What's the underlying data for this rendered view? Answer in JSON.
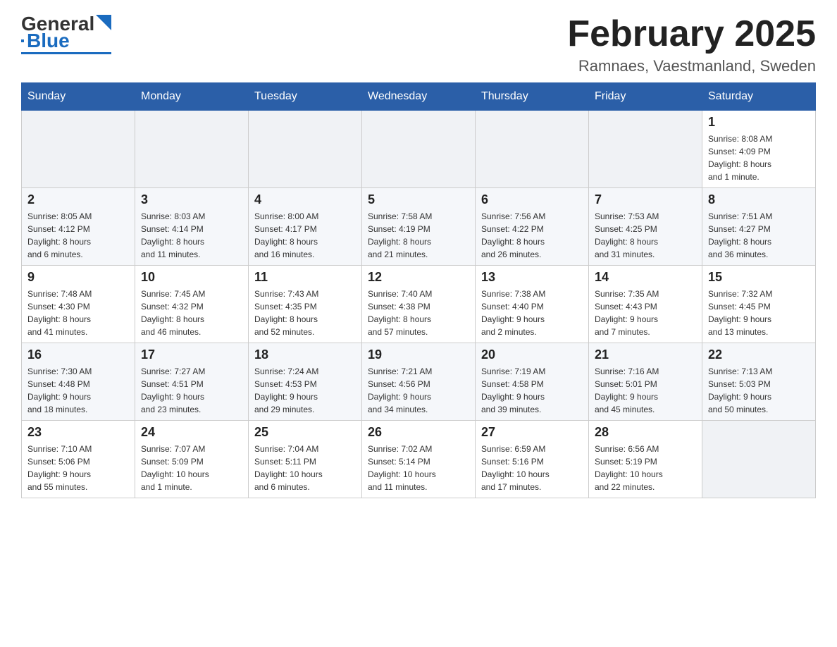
{
  "header": {
    "logo_general": "General",
    "logo_blue": "Blue",
    "title": "February 2025",
    "subtitle": "Ramnaes, Vaestmanland, Sweden"
  },
  "weekdays": [
    "Sunday",
    "Monday",
    "Tuesday",
    "Wednesday",
    "Thursday",
    "Friday",
    "Saturday"
  ],
  "weeks": [
    [
      {
        "day": "",
        "info": ""
      },
      {
        "day": "",
        "info": ""
      },
      {
        "day": "",
        "info": ""
      },
      {
        "day": "",
        "info": ""
      },
      {
        "day": "",
        "info": ""
      },
      {
        "day": "",
        "info": ""
      },
      {
        "day": "1",
        "info": "Sunrise: 8:08 AM\nSunset: 4:09 PM\nDaylight: 8 hours\nand 1 minute."
      }
    ],
    [
      {
        "day": "2",
        "info": "Sunrise: 8:05 AM\nSunset: 4:12 PM\nDaylight: 8 hours\nand 6 minutes."
      },
      {
        "day": "3",
        "info": "Sunrise: 8:03 AM\nSunset: 4:14 PM\nDaylight: 8 hours\nand 11 minutes."
      },
      {
        "day": "4",
        "info": "Sunrise: 8:00 AM\nSunset: 4:17 PM\nDaylight: 8 hours\nand 16 minutes."
      },
      {
        "day": "5",
        "info": "Sunrise: 7:58 AM\nSunset: 4:19 PM\nDaylight: 8 hours\nand 21 minutes."
      },
      {
        "day": "6",
        "info": "Sunrise: 7:56 AM\nSunset: 4:22 PM\nDaylight: 8 hours\nand 26 minutes."
      },
      {
        "day": "7",
        "info": "Sunrise: 7:53 AM\nSunset: 4:25 PM\nDaylight: 8 hours\nand 31 minutes."
      },
      {
        "day": "8",
        "info": "Sunrise: 7:51 AM\nSunset: 4:27 PM\nDaylight: 8 hours\nand 36 minutes."
      }
    ],
    [
      {
        "day": "9",
        "info": "Sunrise: 7:48 AM\nSunset: 4:30 PM\nDaylight: 8 hours\nand 41 minutes."
      },
      {
        "day": "10",
        "info": "Sunrise: 7:45 AM\nSunset: 4:32 PM\nDaylight: 8 hours\nand 46 minutes."
      },
      {
        "day": "11",
        "info": "Sunrise: 7:43 AM\nSunset: 4:35 PM\nDaylight: 8 hours\nand 52 minutes."
      },
      {
        "day": "12",
        "info": "Sunrise: 7:40 AM\nSunset: 4:38 PM\nDaylight: 8 hours\nand 57 minutes."
      },
      {
        "day": "13",
        "info": "Sunrise: 7:38 AM\nSunset: 4:40 PM\nDaylight: 9 hours\nand 2 minutes."
      },
      {
        "day": "14",
        "info": "Sunrise: 7:35 AM\nSunset: 4:43 PM\nDaylight: 9 hours\nand 7 minutes."
      },
      {
        "day": "15",
        "info": "Sunrise: 7:32 AM\nSunset: 4:45 PM\nDaylight: 9 hours\nand 13 minutes."
      }
    ],
    [
      {
        "day": "16",
        "info": "Sunrise: 7:30 AM\nSunset: 4:48 PM\nDaylight: 9 hours\nand 18 minutes."
      },
      {
        "day": "17",
        "info": "Sunrise: 7:27 AM\nSunset: 4:51 PM\nDaylight: 9 hours\nand 23 minutes."
      },
      {
        "day": "18",
        "info": "Sunrise: 7:24 AM\nSunset: 4:53 PM\nDaylight: 9 hours\nand 29 minutes."
      },
      {
        "day": "19",
        "info": "Sunrise: 7:21 AM\nSunset: 4:56 PM\nDaylight: 9 hours\nand 34 minutes."
      },
      {
        "day": "20",
        "info": "Sunrise: 7:19 AM\nSunset: 4:58 PM\nDaylight: 9 hours\nand 39 minutes."
      },
      {
        "day": "21",
        "info": "Sunrise: 7:16 AM\nSunset: 5:01 PM\nDaylight: 9 hours\nand 45 minutes."
      },
      {
        "day": "22",
        "info": "Sunrise: 7:13 AM\nSunset: 5:03 PM\nDaylight: 9 hours\nand 50 minutes."
      }
    ],
    [
      {
        "day": "23",
        "info": "Sunrise: 7:10 AM\nSunset: 5:06 PM\nDaylight: 9 hours\nand 55 minutes."
      },
      {
        "day": "24",
        "info": "Sunrise: 7:07 AM\nSunset: 5:09 PM\nDaylight: 10 hours\nand 1 minute."
      },
      {
        "day": "25",
        "info": "Sunrise: 7:04 AM\nSunset: 5:11 PM\nDaylight: 10 hours\nand 6 minutes."
      },
      {
        "day": "26",
        "info": "Sunrise: 7:02 AM\nSunset: 5:14 PM\nDaylight: 10 hours\nand 11 minutes."
      },
      {
        "day": "27",
        "info": "Sunrise: 6:59 AM\nSunset: 5:16 PM\nDaylight: 10 hours\nand 17 minutes."
      },
      {
        "day": "28",
        "info": "Sunrise: 6:56 AM\nSunset: 5:19 PM\nDaylight: 10 hours\nand 22 minutes."
      },
      {
        "day": "",
        "info": ""
      }
    ]
  ]
}
